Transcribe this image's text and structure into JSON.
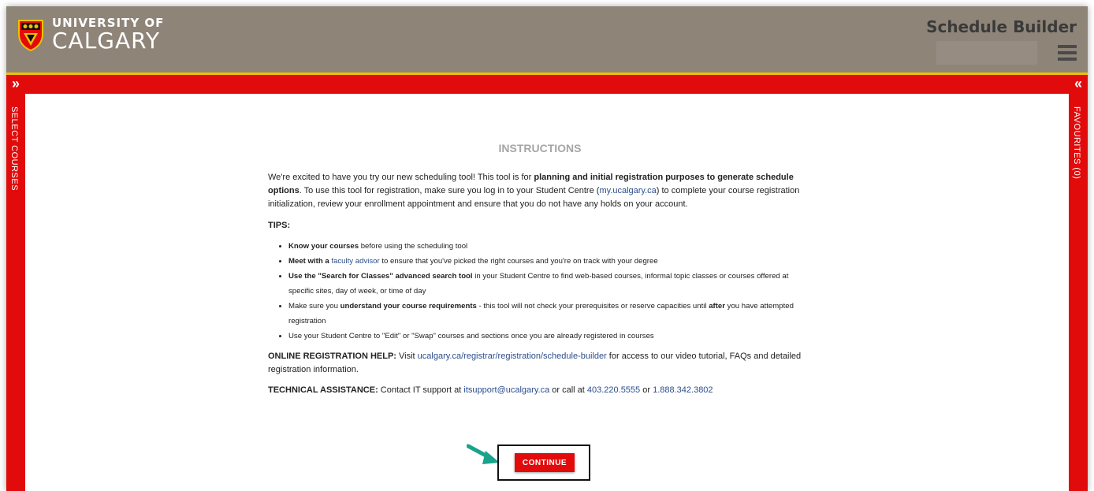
{
  "header": {
    "logo_top": "UNIVERSITY OF",
    "logo_bottom": "CALGARY",
    "app_title": "Schedule Builder",
    "menu_icon": "hamburger-icon"
  },
  "sidebars": {
    "left_label": "SELECT COURSES",
    "left_chevron": "»",
    "right_label": "FAVOURITES (0)",
    "right_chevron": "«"
  },
  "instructions": {
    "title": "INSTRUCTIONS",
    "intro_1": "We're excited to have you try our new scheduling tool! This tool is for ",
    "intro_bold": "planning and initial registration purposes to generate schedule options",
    "intro_2": ". To use this tool for registration, make sure you log in to your Student Centre (",
    "intro_link": "my.ucalgary.ca",
    "intro_3": ") to complete your course registration initialization, review your enrollment appointment and ensure that you do not have any holds on your account.",
    "tips_title": "TIPS:",
    "tip1_bold": "Know your courses",
    "tip1_rest": " before using the scheduling tool",
    "tip2_bold": "Meet with a ",
    "tip2_link": "faculty advisor",
    "tip2_rest": " to ensure that you've picked the right courses and you're on track with your degree",
    "tip3_bold": "Use the \"Search for Classes\" advanced search tool",
    "tip3_rest": " in your Student Centre to find web-based courses, informal topic classes or courses offered at specific sites, day of week, or time of day",
    "tip4_a": "Make sure you ",
    "tip4_bold": "understand your course requirements",
    "tip4_b": " - this tool will not check your prerequisites or reserve capacities until ",
    "tip4_bold2": "after",
    "tip4_c": " you have attempted registration",
    "tip5": "Use your Student Centre to \"Edit\" or \"Swap\" courses and sections once you are already registered in courses",
    "online_label": "ONLINE REGISTRATION HELP:",
    "online_a": " Visit ",
    "online_link": "ucalgary.ca/registrar/registration/schedule-builder",
    "online_b": " for access to our video tutorial, FAQs and detailed registration information.",
    "tech_label": "TECHNICAL ASSISTANCE:",
    "tech_a": " Contact IT support at ",
    "tech_email": "itsupport@ucalgary.ca",
    "tech_b": " or call at ",
    "tech_phone1": "403.220.5555",
    "tech_c": " or ",
    "tech_phone2": "1.888.342.3802"
  },
  "continue_label": "CONTINUE",
  "colors": {
    "header": "#8e8478",
    "accent_red": "#e20b0b",
    "header_rule": "#f2c200",
    "arrow": "#1aa38a"
  }
}
